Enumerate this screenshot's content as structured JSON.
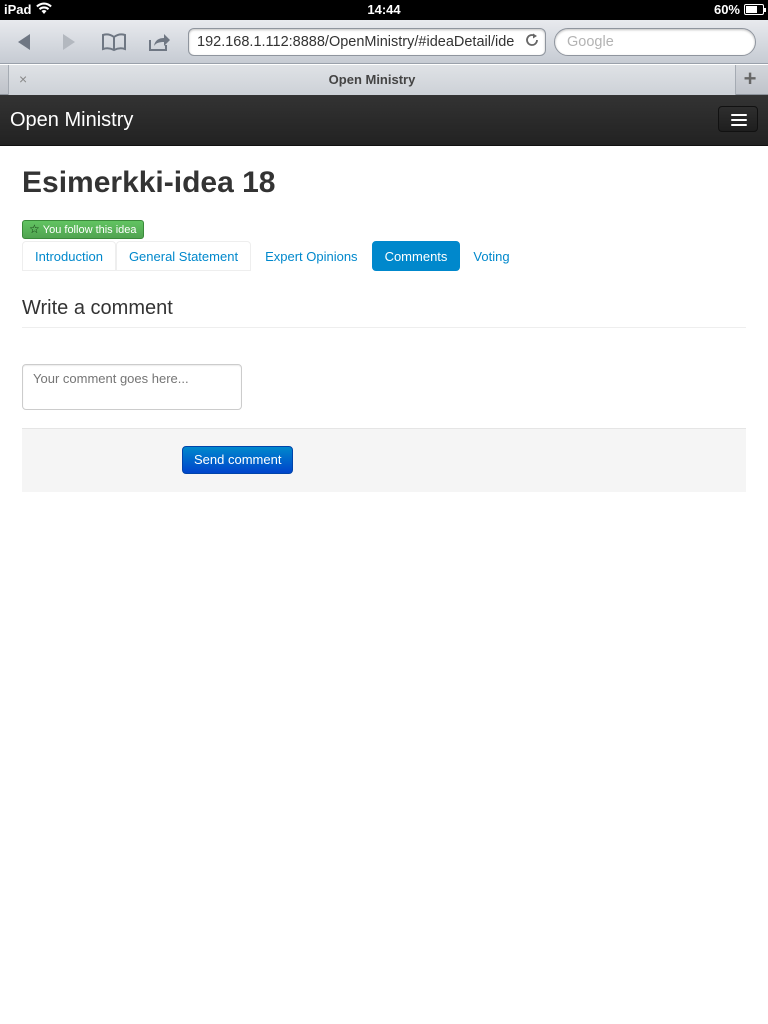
{
  "status_bar": {
    "device": "iPad",
    "time": "14:44",
    "battery": "60%"
  },
  "browser": {
    "url": "192.168.1.112:8888/OpenMinistry/#ideaDetail/ide",
    "search_placeholder": "Google",
    "tab_title": "Open Ministry",
    "tab_close": "×",
    "new_tab": "+"
  },
  "navbar": {
    "brand": "Open Ministry"
  },
  "idea": {
    "title": "Esimerkki-idea 18",
    "follow_label": "You follow this idea"
  },
  "tabs": [
    {
      "label": "Introduction",
      "active": false
    },
    {
      "label": "General Statement",
      "active": false
    },
    {
      "label": "Expert Opinions",
      "active": false
    },
    {
      "label": "Comments",
      "active": true
    },
    {
      "label": "Voting",
      "active": false
    }
  ],
  "comment_form": {
    "heading": "Write a comment",
    "placeholder": "Your comment goes here...",
    "value": "",
    "submit_label": "Send comment"
  },
  "colors": {
    "accent": "#0088cc",
    "navbar": "#222222",
    "success": "#51a351",
    "button_primary": "#0044cc"
  }
}
